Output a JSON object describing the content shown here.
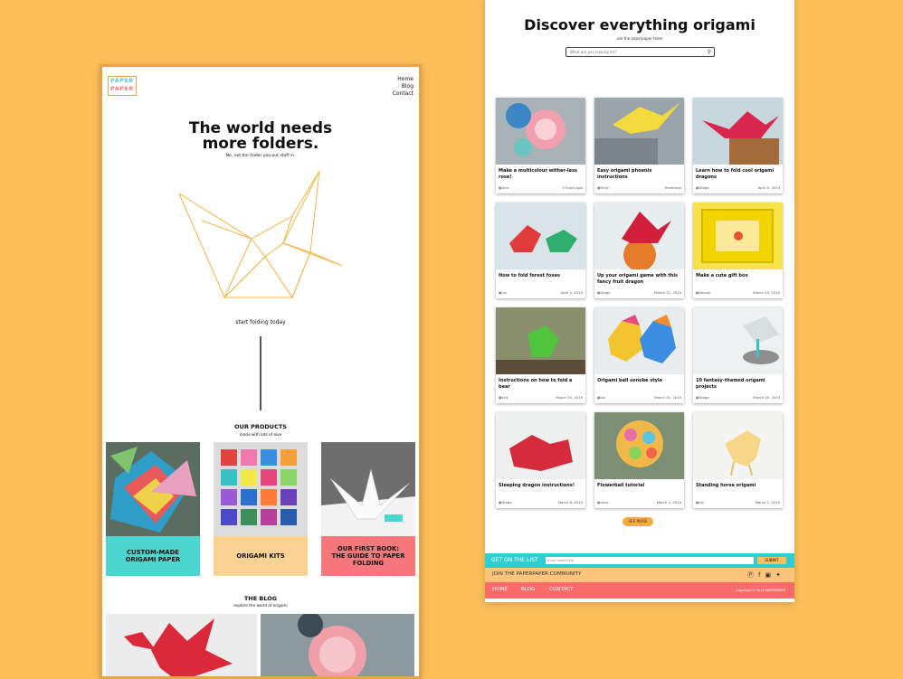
{
  "left_page": {
    "logo": [
      "PAPER",
      "PAPER"
    ],
    "nav": [
      "Home",
      "Blog",
      "Contact"
    ],
    "hero": {
      "title_line1": "The world needs",
      "title_line2": "more folders.",
      "subtitle": "No, not the folder you put stuff in."
    },
    "cta": "start folding today",
    "products": {
      "title": "OUR PRODUCTS",
      "subtitle": "made with lots of love",
      "items": [
        {
          "label": "CUSTOM-MADE ORIGAMI PAPER",
          "color": "#4dd6d0"
        },
        {
          "label": "ORIGAMI KITS",
          "color": "#fcd293"
        },
        {
          "label": "OUR FIRST BOOK: THE GUIDE TO PAPER FOLDING",
          "color": "#f7777d"
        }
      ]
    },
    "blog": {
      "title": "THE BLOG",
      "subtitle": "explore the world of origami"
    }
  },
  "right_page": {
    "title": "Discover everything origami",
    "subtitle": "ask the paperpaper team",
    "search_placeholder": "What are you looking for?",
    "cards": [
      {
        "title": "Make a multicolour wither-less rose!",
        "user": "Ana",
        "date": "5 hours ago"
      },
      {
        "title": "Easy origami phoenix instructions",
        "user": "Holly",
        "date": "Yesterday"
      },
      {
        "title": "Learn how to fold cool origami dragons",
        "user": "Diego",
        "date": "April 8, 2019"
      },
      {
        "title": "How to fold forest foxes",
        "user": "Jun",
        "date": "April 2, 2019"
      },
      {
        "title": "Up your origami game with this fancy fruit dragon",
        "user": "Diego",
        "date": "March 31, 2019"
      },
      {
        "title": "Make a cute gift box",
        "user": "Seojun",
        "date": "March 29, 2019"
      },
      {
        "title": "Instructions on how to fold a bear",
        "user": "Erik",
        "date": "March 20, 2019"
      },
      {
        "title": "Origami ball sonobe style",
        "user": "Jun",
        "date": "March 20, 2019"
      },
      {
        "title": "10 fantasy-themed origami projects",
        "user": "Diego",
        "date": "March 16, 2019"
      },
      {
        "title": "Sleeping dragon instructions!",
        "user": "Diego",
        "date": "March 8, 2019"
      },
      {
        "title": "Flowerball tutorial",
        "user": "Imaz",
        "date": "March 4, 2019"
      },
      {
        "title": "Standing horse origami",
        "user": "Jun",
        "date": "March 2, 2019"
      }
    ],
    "see_more": "SEE MORE",
    "newsletter": {
      "label": "GET ON THE LIST",
      "placeholder": "Enter email here",
      "button": "SUBMIT"
    },
    "community": {
      "label": "JOIN THE PAPERPAPER COMMUNITY",
      "icons": [
        "pinterest-icon",
        "facebook-icon",
        "instagram-icon",
        "twitter-icon"
      ]
    },
    "footer": {
      "links": [
        "HOME",
        "BLOG",
        "CONTACT"
      ],
      "copyright": "Copyright © 2019 PAPERPAPER"
    }
  }
}
